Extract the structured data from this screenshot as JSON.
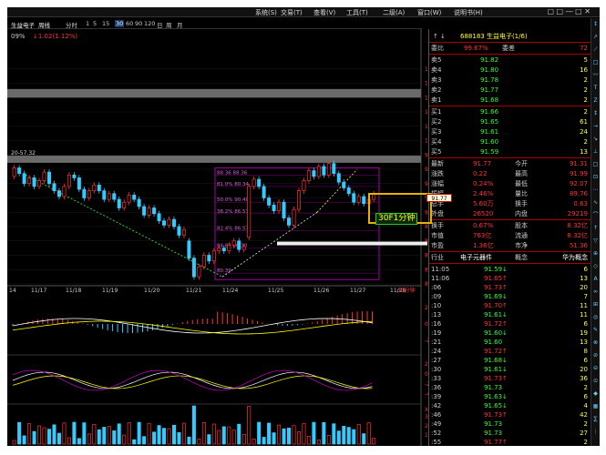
{
  "menu": [
    "系统(S)",
    "交易(T)",
    "查看(V)",
    "工具(T)",
    "二级(A)",
    "窗口(W)",
    "说明书(H)"
  ],
  "win_controls": "▢ □ ― □ ✕",
  "toolbar": {
    "stock_label": "生益电子",
    "period_label": "周线",
    "items": [
      "分时",
      "1",
      "5",
      "15",
      "30",
      "60",
      "90",
      "120",
      "日",
      "周",
      "月"
    ],
    "selected": "30"
  },
  "chart_header": {
    "percent": "09%",
    "change": "↓1.02(1.12%)"
  },
  "price_axis": [
    "110.00",
    "108.00",
    "106.00",
    "104.00",
    "102.00",
    "100.00",
    "98.00",
    "96.00",
    "94.00",
    "92.00",
    "90.00",
    "88.00",
    "86.00",
    "84.00",
    "82.00",
    "80.00"
  ],
  "date_axis": [
    "14",
    "11/17",
    "11/18",
    "11/19",
    "11/20",
    "11/21",
    "11/24",
    "11/25",
    "11/26",
    "11/27",
    "11/28"
  ],
  "date_axis_right": "30分钟",
  "left_level": "20-57.32",
  "fib_labels": [
    "88.36 88.36",
    "81.0% 80.34",
    "50.0% 90.40",
    "38.2% 86.57",
    "82.4% 86.57",
    "84.82 80.30",
    "80.39"
  ],
  "macd_axis": [
    "2",
    "0",
    "-2"
  ],
  "kdj_axis": [
    "2",
    "0",
    "-2",
    "-4"
  ],
  "volume_unit": "X万",
  "volume_axis": [
    "300",
    "200",
    "100"
  ],
  "quote": {
    "code_name": "688183 生益电子(1/6)",
    "weibi": "委比",
    "weibi_val": "99.67%",
    "weicha": "委差",
    "weicha_val": "72",
    "asks": [
      {
        "l": "卖5",
        "p": "91.82",
        "v": "5"
      },
      {
        "l": "卖4",
        "p": "91.80",
        "v": "16"
      },
      {
        "l": "卖3",
        "p": "91.78",
        "v": "2"
      },
      {
        "l": "卖2",
        "p": "91.77",
        "v": "2"
      },
      {
        "l": "卖1",
        "p": "91.68",
        "v": "2"
      }
    ],
    "bids": [
      {
        "l": "买1",
        "p": "91.66",
        "v": "2"
      },
      {
        "l": "买2",
        "p": "91.65",
        "v": "61"
      },
      {
        "l": "买3",
        "p": "91.61",
        "v": "24"
      },
      {
        "l": "买4",
        "p": "91.60",
        "v": "2"
      },
      {
        "l": "买5",
        "p": "91.59",
        "v": "13"
      }
    ],
    "stats": [
      {
        "a": "最新",
        "b": "91.77",
        "c": "今开",
        "d": "91.31"
      },
      {
        "a": "涨跌",
        "b": "0.22",
        "c": "最高",
        "d": "91.99"
      },
      {
        "a": "涨幅",
        "b": "0.24%",
        "c": "最低",
        "d": "92.07"
      },
      {
        "a": "振幅",
        "b": "2.46%",
        "c": "量比",
        "d": "89.76"
      },
      {
        "a": "总手",
        "b": "5.60万",
        "c": "换手",
        "d": "0.63"
      },
      {
        "a": "外盘",
        "b": "26520",
        "c": "内盘",
        "d": "29219"
      }
    ],
    "stats2": [
      {
        "a": "换手",
        "b": "0.67%",
        "c": "股本",
        "d": "8.32亿"
      },
      {
        "a": "市值",
        "b": "763亿",
        "c": "流通",
        "d": "8.32亿"
      },
      {
        "a": "市盈",
        "b": "1.36亿",
        "c": "市净",
        "d": "51.36"
      }
    ],
    "industry": {
      "a": "行业",
      "b": "电子元器件",
      "c": "概念",
      "d": "华为概念"
    },
    "ticks": [
      {
        "t": "11:05",
        "p": "91.59↓",
        "v": "6"
      },
      {
        "t": "11:06",
        "p": "91.65↑",
        "v": "13"
      },
      {
        "t": ":06",
        "p": "91.73↑",
        "v": "20"
      },
      {
        "t": ":09",
        "p": "91.69↓",
        "v": "7"
      },
      {
        "t": ":10",
        "p": "91.70↑",
        "v": "11"
      },
      {
        "t": ":13",
        "p": "91.61↓",
        "v": "11"
      },
      {
        "t": ":16",
        "p": "91.72↑",
        "v": "6"
      },
      {
        "t": ":19",
        "p": "91.60↓",
        "v": "19"
      },
      {
        "t": ":21",
        "p": "91.60",
        "v": "13"
      },
      {
        "t": ":24",
        "p": "91.72↑",
        "v": "8"
      },
      {
        "t": ":27",
        "p": "91.68↓",
        "v": "6"
      },
      {
        "t": ":30",
        "p": "91.61↓",
        "v": "20"
      },
      {
        "t": ":33",
        "p": "91.73↑",
        "v": "36"
      },
      {
        "t": ":36",
        "p": "91.73",
        "v": "2"
      },
      {
        "t": ":39",
        "p": "91.63↓",
        "v": "6"
      },
      {
        "t": ":42",
        "p": "91.65↓",
        "v": "4"
      },
      {
        "t": ":46",
        "p": "91.73↑",
        "v": "42"
      },
      {
        "t": ":49",
        "p": "91.73",
        "v": "2"
      },
      {
        "t": ":52",
        "p": "91.73",
        "v": "27"
      },
      {
        "t": ":55",
        "p": "91.77↑",
        "v": "2"
      }
    ]
  },
  "popup": {
    "label": "30F1分钟",
    "value": "91.77"
  },
  "right_sidebar_icons": [
    "↕",
    "↗",
    "⟋",
    "□",
    "〰",
    "T",
    "Z",
    "↕",
    "→",
    "↘",
    "⊥",
    "□",
    "⊡",
    "⋯",
    "∿",
    "⌒",
    "↑",
    "▽",
    "⊕",
    "◇",
    "A",
    "∞",
    "⊞",
    "◎",
    "✎",
    "⊗",
    "⊘",
    "⊖",
    "⊙",
    "◆",
    "▦",
    "∑",
    "⋮"
  ],
  "chart_data": {
    "type": "candlestick",
    "title": "",
    "xlabel": "",
    "ylabel": "",
    "ylim": [
      80,
      112
    ],
    "candles": [
      {
        "o": 95.0,
        "c": 96.2
      },
      {
        "o": 96.2,
        "c": 95.4
      },
      {
        "o": 95.4,
        "c": 94.0
      },
      {
        "o": 94.0,
        "c": 94.8
      },
      {
        "o": 94.8,
        "c": 93.6
      },
      {
        "o": 93.6,
        "c": 94.4
      },
      {
        "o": 94.4,
        "c": 95.6
      },
      {
        "o": 95.6,
        "c": 94.0
      },
      {
        "o": 94.0,
        "c": 93.0
      },
      {
        "o": 93.0,
        "c": 92.2
      },
      {
        "o": 92.2,
        "c": 93.6
      },
      {
        "o": 93.6,
        "c": 95.2
      },
      {
        "o": 95.2,
        "c": 94.8
      },
      {
        "o": 94.8,
        "c": 93.2
      },
      {
        "o": 93.2,
        "c": 92.0
      },
      {
        "o": 92.0,
        "c": 93.0
      },
      {
        "o": 93.0,
        "c": 93.8
      },
      {
        "o": 93.8,
        "c": 93.0
      },
      {
        "o": 93.0,
        "c": 91.8
      },
      {
        "o": 91.8,
        "c": 92.6
      },
      {
        "o": 92.6,
        "c": 91.8
      },
      {
        "o": 91.8,
        "c": 90.6
      },
      {
        "o": 90.6,
        "c": 91.4
      },
      {
        "o": 91.4,
        "c": 92.4
      },
      {
        "o": 92.4,
        "c": 91.8
      },
      {
        "o": 91.8,
        "c": 90.8
      },
      {
        "o": 90.8,
        "c": 89.6
      },
      {
        "o": 89.6,
        "c": 90.6
      },
      {
        "o": 90.6,
        "c": 89.8
      },
      {
        "o": 89.8,
        "c": 88.8
      },
      {
        "o": 88.8,
        "c": 88.2
      },
      {
        "o": 88.2,
        "c": 89.0
      },
      {
        "o": 89.0,
        "c": 88.0
      },
      {
        "o": 88.0,
        "c": 86.8
      },
      {
        "o": 86.8,
        "c": 87.6
      },
      {
        "o": 86.0,
        "c": 83.6
      },
      {
        "o": 83.6,
        "c": 81.0
      },
      {
        "o": 81.0,
        "c": 82.4
      },
      {
        "o": 82.4,
        "c": 84.0
      },
      {
        "o": 84.0,
        "c": 83.2
      },
      {
        "o": 83.2,
        "c": 84.6
      },
      {
        "o": 84.6,
        "c": 85.0
      },
      {
        "o": 85.0,
        "c": 84.6
      },
      {
        "o": 84.6,
        "c": 85.4
      },
      {
        "o": 85.4,
        "c": 86.0
      },
      {
        "o": 86.0,
        "c": 84.8
      },
      {
        "o": 84.8,
        "c": 85.2
      },
      {
        "o": 86.5,
        "c": 93.6
      },
      {
        "o": 93.6,
        "c": 94.6
      },
      {
        "o": 94.6,
        "c": 93.6
      },
      {
        "o": 93.6,
        "c": 92.0
      },
      {
        "o": 92.0,
        "c": 91.0
      },
      {
        "o": 91.0,
        "c": 90.2
      },
      {
        "o": 90.2,
        "c": 91.4
      },
      {
        "o": 91.4,
        "c": 89.2
      },
      {
        "o": 89.2,
        "c": 88.2
      },
      {
        "o": 88.2,
        "c": 90.4
      },
      {
        "o": 90.4,
        "c": 93.0
      },
      {
        "o": 93.0,
        "c": 94.4
      },
      {
        "o": 94.4,
        "c": 95.8
      },
      {
        "o": 95.8,
        "c": 95.0
      },
      {
        "o": 95.0,
        "c": 96.4
      },
      {
        "o": 96.4,
        "c": 95.2
      },
      {
        "o": 95.2,
        "c": 96.8
      },
      {
        "o": 96.8,
        "c": 95.4
      },
      {
        "o": 95.4,
        "c": 94.2
      },
      {
        "o": 94.2,
        "c": 93.4
      },
      {
        "o": 93.4,
        "c": 92.6
      },
      {
        "o": 92.6,
        "c": 91.4
      },
      {
        "o": 91.4,
        "c": 92.2
      },
      {
        "o": 92.2,
        "c": 91.2
      },
      {
        "o": 91.2,
        "c": 91.8
      },
      {
        "o": 91.8,
        "c": 92.6
      }
    ]
  }
}
